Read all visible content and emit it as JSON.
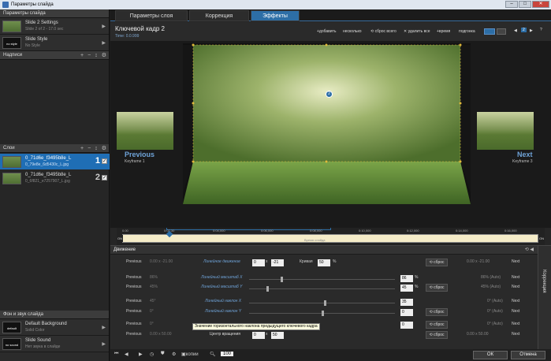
{
  "window": {
    "title": "Параметры слайда"
  },
  "left": {
    "slide_params": "Параметры слайда",
    "slide_settings": {
      "title": "Slide 2 Settings",
      "sub": "Slide 2 of 2 - 17.0 sec"
    },
    "slide_style": {
      "thumb": "no style",
      "title": "Slide Style",
      "sub": "No Style"
    },
    "captions": "Надписи",
    "layers": "Слои",
    "layer_items": [
      {
        "title": "0_71d6e_f3495b8e_L",
        "sub": "0_79e8e_6d5430c_L.jpg",
        "num": "1"
      },
      {
        "title": "0_71d6e_f3495b8e_L",
        "sub": "0_6f821_e7257907_L.jpg",
        "num": "2"
      }
    ],
    "bg_sound": "Фон и звук слайда",
    "default_bg": {
      "thumb": "default",
      "title": "Default Background",
      "sub": "Solid Color"
    },
    "slide_sound": {
      "thumb": "no sound",
      "title": "Slide Sound",
      "sub": "Нет звука в слайде"
    }
  },
  "tabs": [
    "Параметры слоя",
    "Коррекция",
    "Эффекты"
  ],
  "kf": {
    "title": "Ключевой кадр 2",
    "time": "Time: 0.0.999",
    "add": "добавить",
    "several": "несколько",
    "reset_all": "сброс всего",
    "delete": "удалить все",
    "time_btn": "время",
    "fit": "подгонка",
    "pages": [
      "1",
      "2"
    ]
  },
  "stage": {
    "prev": "Previous",
    "prev_sub": "Keyframe 1",
    "next": "Next",
    "next_sub": "Keyframe 3",
    "marker": "2"
  },
  "timeline": {
    "ticks": [
      "0.00",
      "0:02.30",
      "0:04,000",
      "0:06,000",
      "0:08,000",
      "0:10,000",
      "0:12,000",
      "0:14,000",
      "0:16,000"
    ],
    "slide_time": "Время слайда",
    "start": "ON",
    "end": "ON"
  },
  "motion": {
    "title": "Движение",
    "side_label": "Коррекция",
    "rows": [
      {
        "prev": "Previous",
        "pval": "0.00 x -21.00",
        "label": "Линейное движение",
        "v1": "0",
        "v2": "-21",
        "extra": "Кривая",
        "v3": "50",
        "unit": "%",
        "reset": "сброс",
        "auto": "0.00 x -21.00",
        "next": "Next"
      },
      {
        "prev": "Previous",
        "pval": "86%",
        "label": "Линейный масштаб X",
        "v1": "86",
        "unit": "%",
        "reset": "",
        "auto": "86% (Auto)",
        "next": "Next"
      },
      {
        "prev": "Previous",
        "pval": "45%",
        "label": "Линейный масштаб Y",
        "v1": "45",
        "unit": "%",
        "reset": "сброс",
        "auto": "45% (Auto)",
        "next": "Next"
      },
      {
        "prev": "Previous",
        "pval": "45°",
        "label": "Линейный наклон X",
        "v1": "35",
        "unit": "",
        "reset": "",
        "auto": "0° (Auto)",
        "next": "Next"
      },
      {
        "prev": "Previous",
        "pval": "0°",
        "label": "Линейный наклон Y",
        "v1": "0",
        "unit": "",
        "reset": "сброс",
        "auto": "0° (Auto)",
        "next": "Next"
      },
      {
        "prev": "Previous",
        "pval": "0°",
        "label": "",
        "v1": "0",
        "unit": "",
        "reset": "сброс",
        "auto": "0° (Auto)",
        "next": "Next"
      },
      {
        "prev": "Previous",
        "pval": "0.00 x 50.00",
        "label": "Центр вращения",
        "v1": "0",
        "v2": "50",
        "unit": "",
        "reset": "сброс",
        "auto": "0.00 x 50.00",
        "next": "Next"
      }
    ],
    "tooltip": "Значение горизонтального наклона предыдущего ключевого кадра"
  },
  "bottom": {
    "copy": "копии",
    "zoom": "100",
    "ok": "ОК",
    "cancel": "Отмена"
  }
}
